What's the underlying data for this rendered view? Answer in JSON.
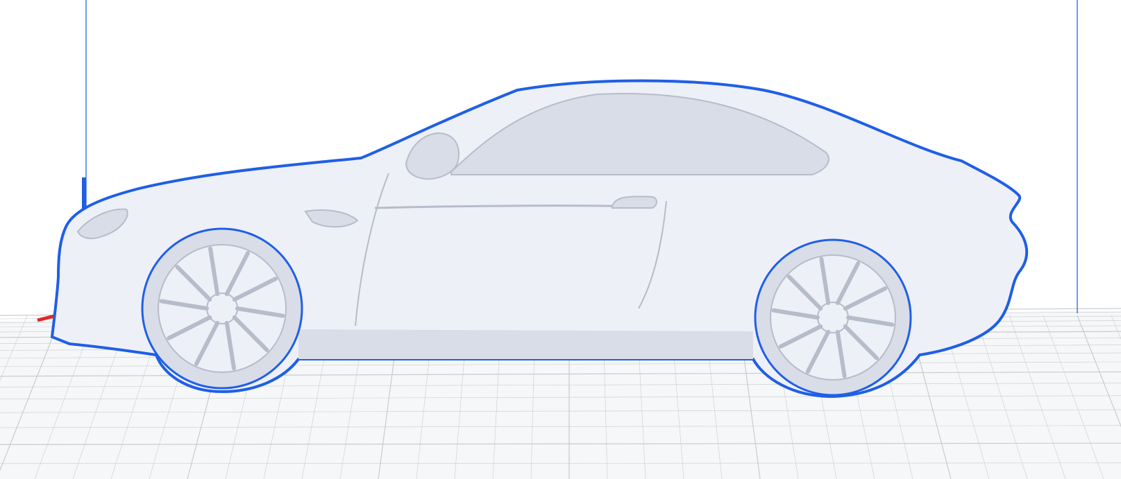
{
  "viewport": {
    "view": "side",
    "model": "car-body",
    "colors": {
      "background": "#ffffff",
      "floor": "#f6f7f8",
      "grid_line": "#c9cbcf",
      "build_volume_edge": "#3d7be6",
      "model_fill": "#eef0f7",
      "model_shade": "#d9dde8",
      "model_line": "#b6bcc9",
      "selection_outline": "#1f5fe6",
      "axis_x": "#e3262a",
      "axis_z": "#1f5fe6"
    },
    "icons": {
      "axis_x": "x-axis-arrow-icon",
      "axis_z": "z-axis-arrow-icon"
    }
  }
}
